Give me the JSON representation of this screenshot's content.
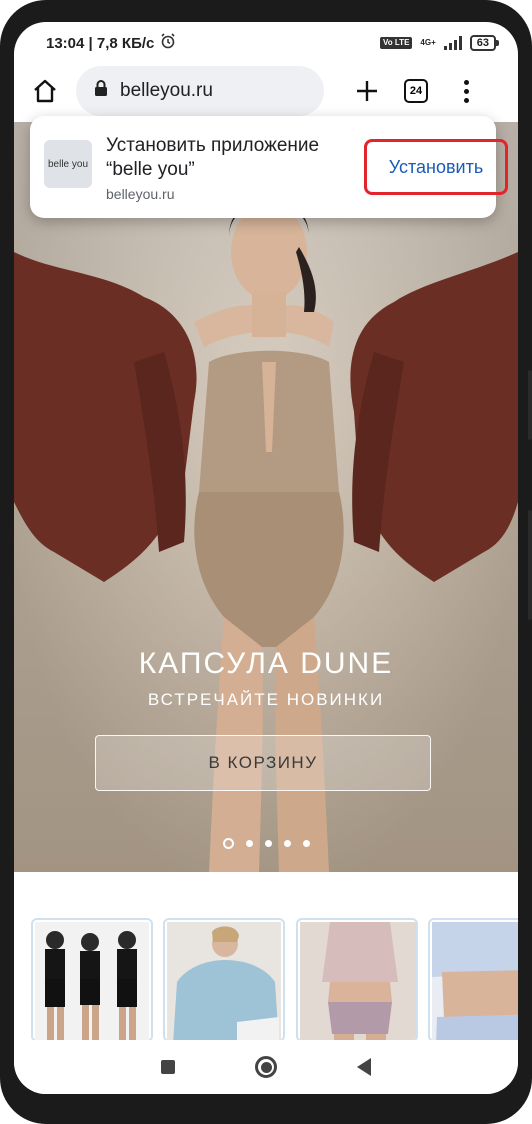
{
  "status_bar": {
    "time_speed": "13:04 | 7,8 КБ/с",
    "volte": "Vo LTE",
    "network": "4G+",
    "battery": "63"
  },
  "browser": {
    "url": "belleyou.ru",
    "tab_count": "24",
    "icons": {
      "home": "home-icon",
      "lock": "lock-icon",
      "new_tab": "plus-icon",
      "tabs": "tabs-icon",
      "menu": "more-vert-icon"
    }
  },
  "install_prompt": {
    "app_icon_text": "belle you",
    "title": "Установить приложение “belle you”",
    "domain": "belleyou.ru",
    "install_label": "Установить",
    "accent": "#1a5bb8",
    "highlight": "#e2242b"
  },
  "hero": {
    "title": "КАПСУЛА DUNE",
    "subtitle": "ВСТРЕЧАЙТЕ НОВИНКИ",
    "cta": "В КОРЗИНУ",
    "slides_total": 5,
    "active_slide": 1
  },
  "thumbnails": [
    {
      "name": "thumb-sport"
    },
    {
      "name": "thumb-sweatshirt"
    },
    {
      "name": "thumb-lingerie"
    },
    {
      "name": "thumb-shirt"
    }
  ],
  "navbar": {
    "icons": [
      "recents-icon",
      "home-circle-icon",
      "back-icon"
    ]
  }
}
